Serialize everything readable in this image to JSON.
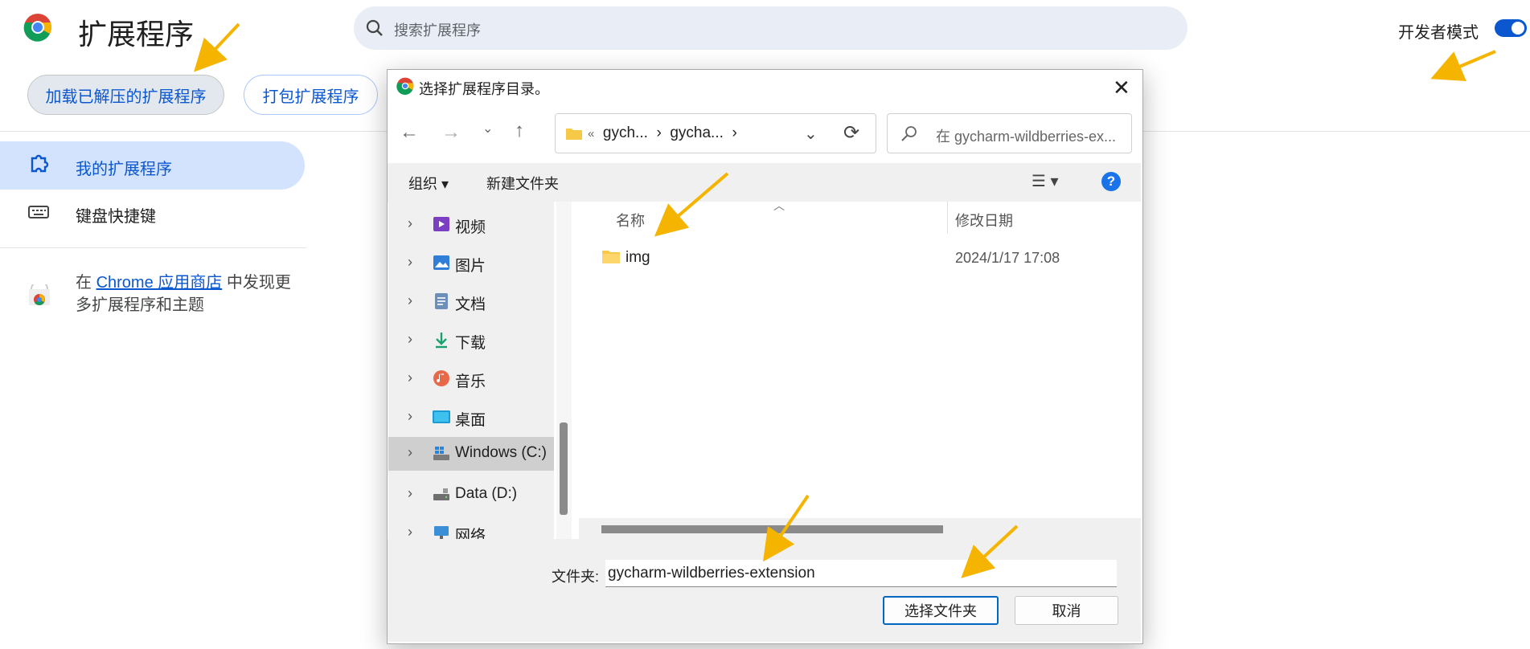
{
  "page": {
    "title": "扩展程序",
    "search_placeholder": "搜索扩展程序",
    "dev_mode_label": "开发者模式",
    "dev_mode_on": true,
    "buttons": {
      "load_unpacked": "加载已解压的扩展程序",
      "pack": "打包扩展程序"
    },
    "nav": {
      "my_extensions": "我的扩展程序",
      "shortcuts": "键盘快捷键"
    },
    "store": {
      "prefix": "在 ",
      "link": "Chrome 应用商店",
      "suffix": " 中发现更多扩展程序和主题"
    }
  },
  "dialog": {
    "title": "选择扩展程序目录。",
    "close": "✕",
    "address": {
      "prefix": "«",
      "parts": [
        "gych...",
        "gycha..."
      ],
      "sep": "›"
    },
    "search_placeholder": "在 gycharm-wildberries-ex...",
    "toolbar": {
      "organize": "组织 ▾",
      "new_folder": "新建文件夹",
      "view": "☰ ▾",
      "help": "?"
    },
    "tree": [
      {
        "label": "视频",
        "icon": "video-icon"
      },
      {
        "label": "图片",
        "icon": "pictures-icon"
      },
      {
        "label": "文档",
        "icon": "documents-icon"
      },
      {
        "label": "下载",
        "icon": "downloads-icon"
      },
      {
        "label": "音乐",
        "icon": "music-icon"
      },
      {
        "label": "桌面",
        "icon": "desktop-icon"
      },
      {
        "label": "Windows (C:)",
        "icon": "drive-c-icon",
        "selected": true
      },
      {
        "label": "Data (D:)",
        "icon": "drive-d-icon"
      },
      {
        "label": "网络",
        "icon": "network-icon"
      }
    ],
    "columns": {
      "name": "名称",
      "date": "修改日期"
    },
    "files": [
      {
        "name": "img",
        "date": "2024/1/17 17:08",
        "icon": "folder-icon"
      }
    ],
    "folder_label": "文件夹:",
    "folder_value": "gycharm-wildberries-extension",
    "select_button": "选择文件夹",
    "cancel_button": "取消"
  },
  "colors": {
    "accent": "#0b57d0",
    "annotation_arrow": "#f5b400"
  }
}
